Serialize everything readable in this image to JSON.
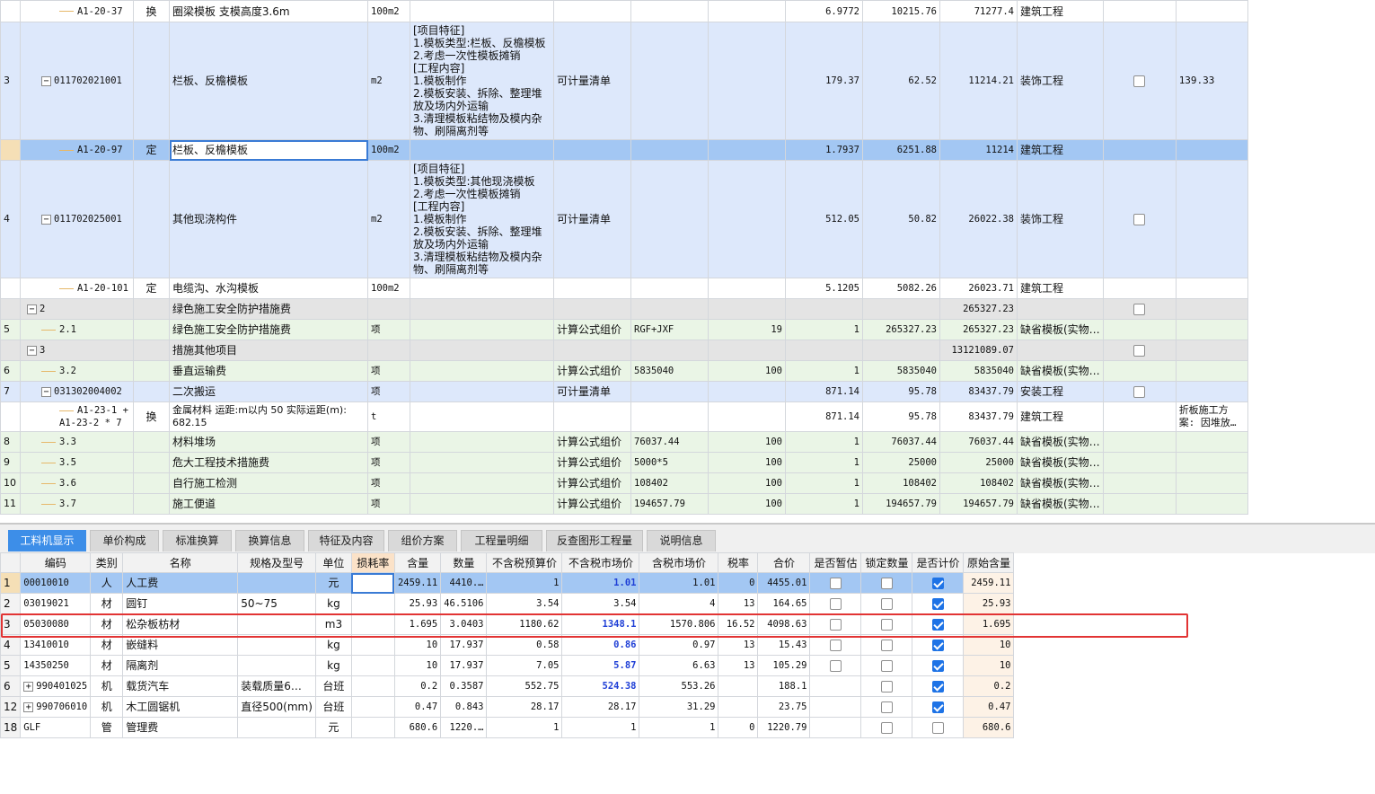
{
  "upper_rows": [
    {
      "idx": "",
      "code": "A1-20-37",
      "kind": "换",
      "name": "圈梁模板 支模高度3.6m",
      "unit": "100m2",
      "feat": "",
      "calc": "",
      "formula": "",
      "rate": "",
      "qty": "6.9772",
      "price": "10215.76",
      "total": "71277.4",
      "major": "建筑工程",
      "check": "",
      "extra": ""
    },
    {
      "idx": "3",
      "code": "011702021001",
      "kind": "",
      "name": "栏板、反檐模板",
      "unit": "m2",
      "feat": "[项目特征]\n1.模板类型:栏板、反檐模板\n2.考虑一次性模板摊销\n[工程内容]\n1.模板制作\n2.模板安装、拆除、整理堆放及场内外运输\n3.清理模板粘结物及模内杂物、刷隔离剂等",
      "calc": "可计量清单",
      "formula": "",
      "rate": "",
      "qty": "179.37",
      "price": "62.52",
      "total": "11214.21",
      "major": "装饰工程",
      "check": "box",
      "extra": "139.33"
    },
    {
      "idx": "",
      "code": "A1-20-97",
      "kind": "定",
      "name": "栏板、反檐模板",
      "unit": "100m2",
      "feat": "",
      "calc": "",
      "formula": "",
      "rate": "",
      "qty": "1.7937",
      "price": "6251.88",
      "total": "11214",
      "major": "建筑工程",
      "check": "",
      "extra": ""
    },
    {
      "idx": "4",
      "code": "011702025001",
      "kind": "",
      "name": "其他现浇构件",
      "unit": "m2",
      "feat": "[项目特征]\n1.模板类型:其他现浇模板\n2.考虑一次性模板摊销\n[工程内容]\n1.模板制作\n2.模板安装、拆除、整理堆放及场内外运输\n3.清理模板粘结物及模内杂物、刷隔离剂等",
      "calc": "可计量清单",
      "formula": "",
      "rate": "",
      "qty": "512.05",
      "price": "50.82",
      "total": "26022.38",
      "major": "装饰工程",
      "check": "box",
      "extra": ""
    },
    {
      "idx": "",
      "code": "A1-20-101",
      "kind": "定",
      "name": "电缆沟、水沟模板",
      "unit": "100m2",
      "feat": "",
      "calc": "",
      "formula": "",
      "rate": "",
      "qty": "5.1205",
      "price": "5082.26",
      "total": "26023.71",
      "major": "建筑工程",
      "check": "",
      "extra": ""
    },
    {
      "idx": "",
      "code": "2",
      "kind": "",
      "name": "绿色施工安全防护措施费",
      "unit": "",
      "feat": "",
      "calc": "",
      "formula": "",
      "rate": "",
      "qty": "",
      "price": "",
      "total": "265327.23",
      "major": "",
      "check": "box",
      "extra": ""
    },
    {
      "idx": "5",
      "code": "2.1",
      "kind": "",
      "name": "绿色施工安全防护措施费",
      "unit": "项",
      "feat": "",
      "calc": "计算公式组价",
      "formula": "RGF+JXF",
      "rate": "19",
      "qty": "1",
      "price": "265327.23",
      "total": "265327.23",
      "major": "缺省模板(实物…",
      "check": "",
      "extra": ""
    },
    {
      "idx": "",
      "code": "3",
      "kind": "",
      "name": "措施其他项目",
      "unit": "",
      "feat": "",
      "calc": "",
      "formula": "",
      "rate": "",
      "qty": "",
      "price": "",
      "total": "13121089.07",
      "major": "",
      "check": "box",
      "extra": ""
    },
    {
      "idx": "6",
      "code": "3.2",
      "kind": "",
      "name": "垂直运输费",
      "unit": "项",
      "feat": "",
      "calc": "计算公式组价",
      "formula": "5835040",
      "rate": "100",
      "qty": "1",
      "price": "5835040",
      "total": "5835040",
      "major": "缺省模板(实物…",
      "check": "",
      "extra": ""
    },
    {
      "idx": "7",
      "code": "031302004002",
      "kind": "",
      "name": "二次搬运",
      "unit": "项",
      "feat": "",
      "calc": "可计量清单",
      "formula": "",
      "rate": "",
      "qty": "871.14",
      "price": "95.78",
      "total": "83437.79",
      "major": "安装工程",
      "check": "box",
      "extra": ""
    },
    {
      "idx": "",
      "code": "A1-23-1 +\nA1-23-2 * 7",
      "kind": "换",
      "name": "金属材料 运距:m以内 50  实际运距(m):\n682.15",
      "unit": "t",
      "feat": "",
      "calc": "",
      "formula": "",
      "rate": "",
      "qty": "871.14",
      "price": "95.78",
      "total": "83437.79",
      "major": "建筑工程",
      "check": "",
      "extra": "折板施工方\n案: 因堆放…"
    },
    {
      "idx": "8",
      "code": "3.3",
      "kind": "",
      "name": "材料堆场",
      "unit": "项",
      "feat": "",
      "calc": "计算公式组价",
      "formula": "76037.44",
      "rate": "100",
      "qty": "1",
      "price": "76037.44",
      "total": "76037.44",
      "major": "缺省模板(实物…",
      "check": "",
      "extra": ""
    },
    {
      "idx": "9",
      "code": "3.5",
      "kind": "",
      "name": "危大工程技术措施费",
      "unit": "项",
      "feat": "",
      "calc": "计算公式组价",
      "formula": "5000*5",
      "rate": "100",
      "qty": "1",
      "price": "25000",
      "total": "25000",
      "major": "缺省模板(实物…",
      "check": "",
      "extra": ""
    },
    {
      "idx": "10",
      "code": "3.6",
      "kind": "",
      "name": "自行施工检测",
      "unit": "项",
      "feat": "",
      "calc": "计算公式组价",
      "formula": "108402",
      "rate": "100",
      "qty": "1",
      "price": "108402",
      "total": "108402",
      "major": "缺省模板(实物…",
      "check": "",
      "extra": ""
    },
    {
      "idx": "11",
      "code": "3.7",
      "kind": "",
      "name": "施工便道",
      "unit": "项",
      "feat": "",
      "calc": "计算公式组价",
      "formula": "194657.79",
      "rate": "100",
      "qty": "1",
      "price": "194657.79",
      "total": "194657.79",
      "major": "缺省模板(实物…",
      "check": "",
      "extra": ""
    }
  ],
  "tabs": [
    "工料机显示",
    "单价构成",
    "标准换算",
    "换算信息",
    "特征及内容",
    "组价方案",
    "工程量明细",
    "反查图形工程量",
    "说明信息"
  ],
  "headers": [
    "编码",
    "类别",
    "名称",
    "规格及型号",
    "单位",
    "损耗率",
    "含量",
    "数量",
    "不含税预算价",
    "不含税市场价",
    "含税市场价",
    "税率",
    "合价",
    "是否暂估",
    "锁定数量",
    "是否计价",
    "原始含量"
  ],
  "lower_rows": [
    {
      "rn": "1",
      "code": "00010010",
      "type": "人",
      "name": "人工费",
      "spec": "",
      "unit": "元",
      "loss": "",
      "content": "2459.11",
      "qty": "4410.…",
      "budget": "1",
      "market": "1.01",
      "taxmarket": "1.01",
      "tax": "0",
      "sum": "4455.01",
      "est": false,
      "lock": false,
      "priced": true,
      "orig": "2459.11"
    },
    {
      "rn": "2",
      "code": "03019021",
      "type": "材",
      "name": "圆钉",
      "spec": "50~75",
      "unit": "kg",
      "loss": "",
      "content": "25.93",
      "qty": "46.5106",
      "budget": "3.54",
      "market": "3.54",
      "taxmarket": "4",
      "tax": "13",
      "sum": "164.65",
      "est": false,
      "lock": false,
      "priced": true,
      "orig": "25.93"
    },
    {
      "rn": "3",
      "code": "05030080",
      "type": "材",
      "name": "松杂板枋材",
      "spec": "",
      "unit": "m3",
      "loss": "",
      "content": "1.695",
      "qty": "3.0403",
      "budget": "1180.62",
      "market": "1348.1",
      "taxmarket": "1570.806",
      "tax": "16.52",
      "sum": "4098.63",
      "est": false,
      "lock": false,
      "priced": true,
      "orig": "1.695"
    },
    {
      "rn": "4",
      "code": "13410010",
      "type": "材",
      "name": "嵌缝料",
      "spec": "",
      "unit": "kg",
      "loss": "",
      "content": "10",
      "qty": "17.937",
      "budget": "0.58",
      "market": "0.86",
      "taxmarket": "0.97",
      "tax": "13",
      "sum": "15.43",
      "est": false,
      "lock": false,
      "priced": true,
      "orig": "10"
    },
    {
      "rn": "5",
      "code": "14350250",
      "type": "材",
      "name": "隔离剂",
      "spec": "",
      "unit": "kg",
      "loss": "",
      "content": "10",
      "qty": "17.937",
      "budget": "7.05",
      "market": "5.87",
      "taxmarket": "6.63",
      "tax": "13",
      "sum": "105.29",
      "est": false,
      "lock": false,
      "priced": true,
      "orig": "10"
    },
    {
      "rn": "6",
      "code": "990401025",
      "type": "机",
      "name": "载货汽车",
      "spec": "装载质量6…",
      "unit": "台班",
      "loss": "",
      "content": "0.2",
      "qty": "0.3587",
      "budget": "552.75",
      "market": "524.38",
      "taxmarket": "553.26",
      "tax": "",
      "sum": "188.1",
      "est": null,
      "lock": false,
      "priced": true,
      "orig": "0.2"
    },
    {
      "rn": "12",
      "code": "990706010",
      "type": "机",
      "name": "木工圆锯机",
      "spec": "直径500(mm)",
      "unit": "台班",
      "loss": "",
      "content": "0.47",
      "qty": "0.843",
      "budget": "28.17",
      "market": "28.17",
      "taxmarket": "31.29",
      "tax": "",
      "sum": "23.75",
      "est": null,
      "lock": false,
      "priced": true,
      "orig": "0.47"
    },
    {
      "rn": "18",
      "code": "GLF",
      "type": "管",
      "name": "管理费",
      "spec": "",
      "unit": "元",
      "loss": "",
      "content": "680.6",
      "qty": "1220.…",
      "budget": "1",
      "market": "1",
      "taxmarket": "1",
      "tax": "0",
      "sum": "1220.79",
      "est": null,
      "lock": false,
      "priced": false,
      "orig": "680.6"
    }
  ]
}
